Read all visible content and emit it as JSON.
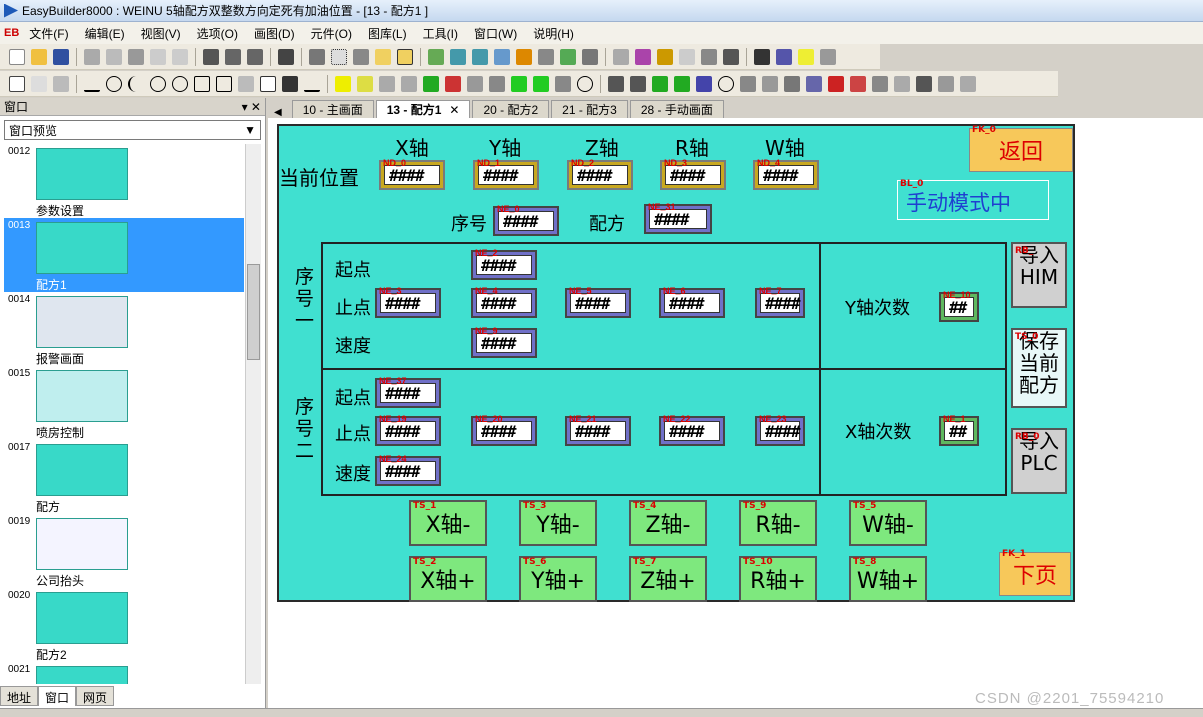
{
  "window": {
    "title": "EasyBuilder8000 : WEINU 5轴配方双整数方向定死有加油位置 - [13 - 配方1 ]"
  },
  "menu": {
    "logo": "EB",
    "items": [
      "文件(F)",
      "编辑(E)",
      "视图(V)",
      "选项(O)",
      "画图(D)",
      "元件(O)",
      "图库(L)",
      "工具(I)",
      "窗口(W)",
      "说明(H)"
    ]
  },
  "left_panel": {
    "header": "窗口",
    "select": "窗口预览",
    "items": [
      {
        "num": "0012",
        "label": "参数设置"
      },
      {
        "num": "0013",
        "label": "配方1"
      },
      {
        "num": "0014",
        "label": "报警画面"
      },
      {
        "num": "0015",
        "label": "喷房控制"
      },
      {
        "num": "0017",
        "label": "配方"
      },
      {
        "num": "0019",
        "label": "公司抬头"
      },
      {
        "num": "0020",
        "label": "配方2"
      },
      {
        "num": "0021",
        "label": ""
      }
    ],
    "tabs": [
      "地址",
      "窗口",
      "网页"
    ]
  },
  "tabs": [
    "10 - 主画面",
    "13 - 配方1",
    "20 - 配方2",
    "21 - 配方3",
    "28 - 手动画面"
  ],
  "screen": {
    "axes": [
      "X轴",
      "Y轴",
      "Z轴",
      "R轴",
      "W轴"
    ],
    "current_pos": "当前位置",
    "nd": [
      "ND_0",
      "ND_1",
      "ND_2",
      "ND_3",
      "ND_4"
    ],
    "hash4": "####",
    "hash2": "##",
    "seq_label": "序号",
    "seq_tag": "NE_0",
    "recipe_label": "配方",
    "recipe_tag": "NE_31",
    "bl": "BL_0",
    "manual_mode": "手动模式中",
    "fk0_tag": "FK_0",
    "back": "返回",
    "fk1_tag": "FK_1",
    "next": "下页",
    "group1": {
      "title": "序号一",
      "start": "起点",
      "stop": "止点",
      "speed": "速度",
      "start_tag": "NE_2",
      "stop_tags": [
        "NE_3",
        "NE_4",
        "NE_5",
        "NE_6",
        "NE_7"
      ],
      "speed_tag": "NE_9",
      "count_label": "Y轴次数",
      "count_tag": "NE_10"
    },
    "group2": {
      "title": "序号二",
      "start": "起点",
      "stop": "止点",
      "speed": "速度",
      "start_tag": "NE_37",
      "stop_tags": [
        "NE_19",
        "NE_20",
        "NE_21",
        "NE_22",
        "NE_23"
      ],
      "speed_tag": "NE_24",
      "count_label": "X轴次数",
      "count_tag": "NE_1"
    },
    "import_him": {
      "tag": "RB_",
      "text": "导入HIM"
    },
    "save": {
      "tag": "TS_0",
      "text": "保存当前配方"
    },
    "import_plc": {
      "tag": "RB_0",
      "text": "导入PLC"
    },
    "minus_buttons": [
      {
        "tag": "TS_1",
        "label": "X轴-"
      },
      {
        "tag": "TS_3",
        "label": "Y轴-"
      },
      {
        "tag": "TS_4",
        "label": "Z轴-"
      },
      {
        "tag": "TS_9",
        "label": "R轴-"
      },
      {
        "tag": "TS_5",
        "label": "W轴-"
      }
    ],
    "plus_buttons": [
      {
        "tag": "TS_2",
        "label": "X轴+"
      },
      {
        "tag": "TS_6",
        "label": "Y轴+"
      },
      {
        "tag": "TS_7",
        "label": "Z轴+"
      },
      {
        "tag": "TS_10",
        "label": "R轴+"
      },
      {
        "tag": "TS_8",
        "label": "W轴+"
      }
    ]
  },
  "watermark": "CSDN @2201_75594210"
}
